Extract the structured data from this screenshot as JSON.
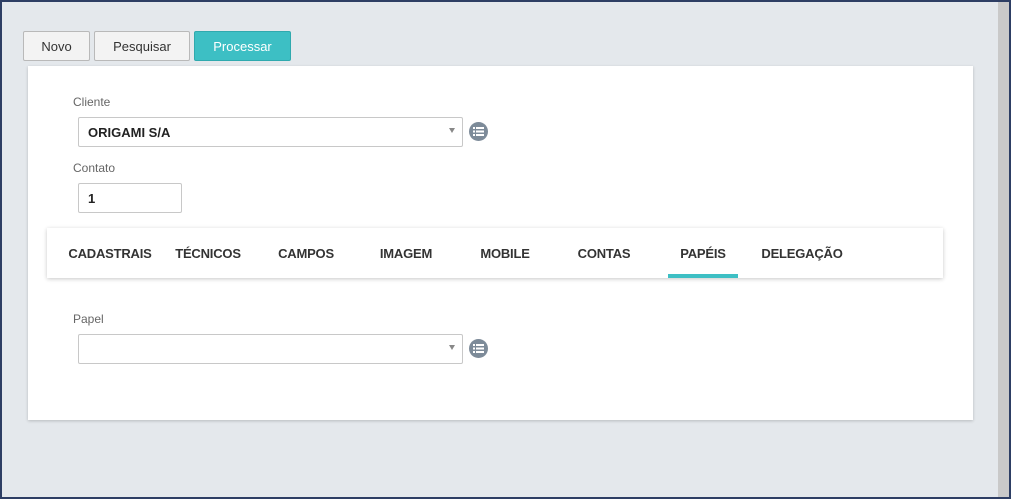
{
  "toolbar": {
    "novo_label": "Novo",
    "pesquisar_label": "Pesquisar",
    "processar_label": "Processar"
  },
  "form": {
    "cliente_label": "Cliente",
    "cliente_value": "ORIGAMI S/A",
    "contato_label": "Contato",
    "contato_value": "1"
  },
  "tabs": [
    {
      "label": "CADASTRAIS",
      "active": false
    },
    {
      "label": "TÉCNICOS",
      "active": false
    },
    {
      "label": "CAMPOS",
      "active": false
    },
    {
      "label": "IMAGEM",
      "active": false
    },
    {
      "label": "MOBILE",
      "active": false
    },
    {
      "label": "CONTAS",
      "active": false
    },
    {
      "label": "PAPÉIS",
      "active": true
    },
    {
      "label": "DELEGAÇÃO",
      "active": false
    }
  ],
  "papel": {
    "label": "Papel",
    "value": ""
  },
  "colors": {
    "accent": "#3dbfc4",
    "background": "#e4e8ec",
    "frame": "#2d3e64"
  },
  "icons": {
    "list": "list-icon",
    "caret": "chevron-down-icon"
  }
}
